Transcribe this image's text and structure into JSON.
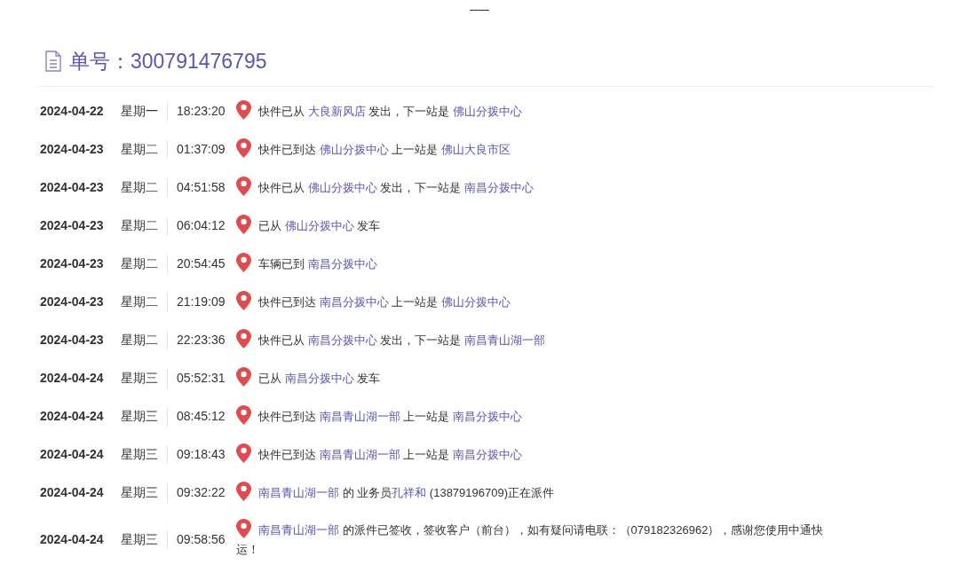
{
  "header": {
    "label": "单号：",
    "number": "300791476795"
  },
  "events": [
    {
      "date": "2024-04-22",
      "weekday": "星期一",
      "time": "18:23:20",
      "parts": [
        {
          "text": "快件已从 ",
          "place": false
        },
        {
          "text": "大良新风店",
          "place": true
        },
        {
          "text": " 发出，下一站是 ",
          "place": false
        },
        {
          "text": "佛山分拨中心",
          "place": true
        }
      ]
    },
    {
      "date": "2024-04-23",
      "weekday": "星期二",
      "time": "01:37:09",
      "parts": [
        {
          "text": "快件已到达 ",
          "place": false
        },
        {
          "text": "佛山分拨中心",
          "place": true
        },
        {
          "text": " 上一站是 ",
          "place": false
        },
        {
          "text": "佛山大良市区",
          "place": true
        }
      ]
    },
    {
      "date": "2024-04-23",
      "weekday": "星期二",
      "time": "04:51:58",
      "parts": [
        {
          "text": "快件已从 ",
          "place": false
        },
        {
          "text": "佛山分拨中心",
          "place": true
        },
        {
          "text": " 发出，下一站是 ",
          "place": false
        },
        {
          "text": "南昌分拨中心",
          "place": true
        }
      ]
    },
    {
      "date": "2024-04-23",
      "weekday": "星期二",
      "time": "06:04:12",
      "parts": [
        {
          "text": "已从 ",
          "place": false
        },
        {
          "text": "佛山分拨中心",
          "place": true
        },
        {
          "text": " 发车",
          "place": false
        }
      ]
    },
    {
      "date": "2024-04-23",
      "weekday": "星期二",
      "time": "20:54:45",
      "parts": [
        {
          "text": "车辆已到 ",
          "place": false
        },
        {
          "text": "南昌分拨中心",
          "place": true
        }
      ]
    },
    {
      "date": "2024-04-23",
      "weekday": "星期二",
      "time": "21:19:09",
      "parts": [
        {
          "text": "快件已到达 ",
          "place": false
        },
        {
          "text": "南昌分拨中心",
          "place": true
        },
        {
          "text": " 上一站是 ",
          "place": false
        },
        {
          "text": "佛山分拨中心",
          "place": true
        }
      ]
    },
    {
      "date": "2024-04-23",
      "weekday": "星期二",
      "time": "22:23:36",
      "parts": [
        {
          "text": "快件已从 ",
          "place": false
        },
        {
          "text": "南昌分拨中心",
          "place": true
        },
        {
          "text": " 发出，下一站是 ",
          "place": false
        },
        {
          "text": "南昌青山湖一部",
          "place": true
        }
      ]
    },
    {
      "date": "2024-04-24",
      "weekday": "星期三",
      "time": "05:52:31",
      "parts": [
        {
          "text": "已从 ",
          "place": false
        },
        {
          "text": "南昌分拨中心",
          "place": true
        },
        {
          "text": " 发车",
          "place": false
        }
      ]
    },
    {
      "date": "2024-04-24",
      "weekday": "星期三",
      "time": "08:45:12",
      "parts": [
        {
          "text": "快件已到达 ",
          "place": false
        },
        {
          "text": "南昌青山湖一部",
          "place": true
        },
        {
          "text": " 上一站是 ",
          "place": false
        },
        {
          "text": "南昌分拨中心",
          "place": true
        }
      ]
    },
    {
      "date": "2024-04-24",
      "weekday": "星期三",
      "time": "09:18:43",
      "parts": [
        {
          "text": "快件已到达 ",
          "place": false
        },
        {
          "text": "南昌青山湖一部",
          "place": true
        },
        {
          "text": " 上一站是 ",
          "place": false
        },
        {
          "text": "南昌分拨中心",
          "place": true
        }
      ]
    },
    {
      "date": "2024-04-24",
      "weekday": "星期三",
      "time": "09:32:22",
      "parts": [
        {
          "text": "南昌青山湖一部",
          "place": true
        },
        {
          "text": " 的 业务员",
          "place": false
        },
        {
          "text": "孔祥和",
          "place": true
        },
        {
          "text": " (13879196709)正在派件",
          "place": false
        }
      ]
    },
    {
      "date": "2024-04-24",
      "weekday": "星期三",
      "time": "09:58:56",
      "parts": [
        {
          "text": "南昌青山湖一部",
          "place": true
        },
        {
          "text": " 的派件已签收，签收客户（前台），如有疑问请电联：（079182326962），感谢您使用中通快运！",
          "place": false
        }
      ]
    }
  ]
}
